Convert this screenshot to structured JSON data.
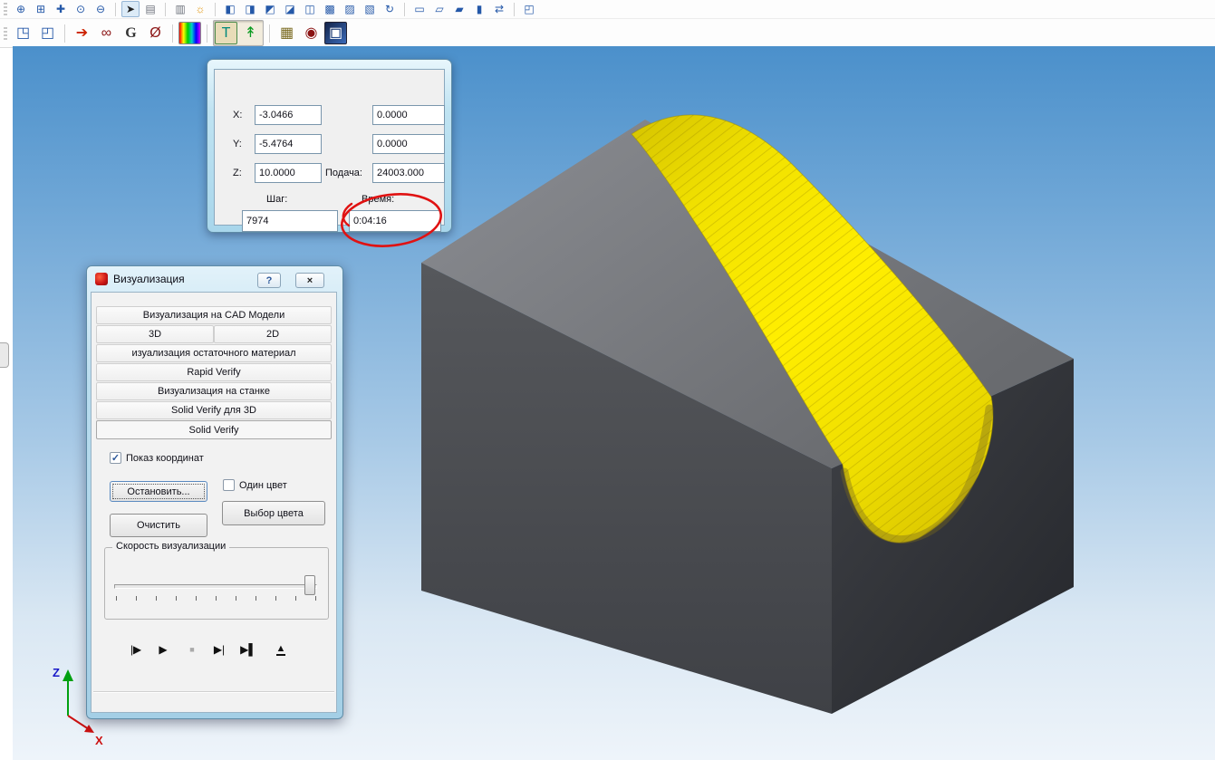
{
  "toolbar_row1": {
    "icons": [
      {
        "name": "zoom-in",
        "glyph": "⊕"
      },
      {
        "name": "zoom-window",
        "glyph": "⊞"
      },
      {
        "name": "pan",
        "glyph": "✚"
      },
      {
        "name": "zoom-dynamic",
        "glyph": "⊙"
      },
      {
        "name": "zoom-previous",
        "glyph": "⊖"
      },
      {
        "name": "select-cursor",
        "glyph": "➤"
      },
      {
        "name": "measure",
        "glyph": "▤"
      },
      {
        "name": "notes",
        "glyph": "▥"
      },
      {
        "name": "light",
        "glyph": "☼"
      },
      {
        "name": "view-front",
        "glyph": "◧"
      },
      {
        "name": "view-back",
        "glyph": "◨"
      },
      {
        "name": "view-left",
        "glyph": "◩"
      },
      {
        "name": "view-right",
        "glyph": "◪"
      },
      {
        "name": "view-top",
        "glyph": "◫"
      },
      {
        "name": "view-bottom",
        "glyph": "▩"
      },
      {
        "name": "view-isometric",
        "glyph": "▨"
      },
      {
        "name": "view-dimetric",
        "glyph": "▧"
      },
      {
        "name": "view-rotate",
        "glyph": "↻"
      },
      {
        "name": "render-wireframe",
        "glyph": "▭"
      },
      {
        "name": "render-hidden-line",
        "glyph": "▱"
      },
      {
        "name": "render-shaded",
        "glyph": "▰"
      },
      {
        "name": "render-solid",
        "glyph": "▮"
      },
      {
        "name": "view-refresh",
        "glyph": "⇄"
      },
      {
        "name": "viewport-layout",
        "glyph": "◰"
      }
    ]
  },
  "toolbar_row2": {
    "icons": [
      {
        "name": "sim-window",
        "glyph": "◳"
      },
      {
        "name": "sim-window-secondary",
        "glyph": "◰"
      },
      {
        "name": "import-toolpath",
        "glyph": "➔"
      },
      {
        "name": "machine-view",
        "glyph": "∞"
      },
      {
        "name": "gcode",
        "glyph": "G"
      },
      {
        "name": "postprocess",
        "glyph": "Ø"
      },
      {
        "name": "color-spectrum",
        "glyph": ""
      },
      {
        "name": "tool-visibility",
        "glyph": "T"
      },
      {
        "name": "toolpath-visibility",
        "glyph": "↟"
      },
      {
        "name": "stock-model",
        "glyph": "▦"
      },
      {
        "name": "collision-check",
        "glyph": "◉"
      },
      {
        "name": "sim-snapshot",
        "glyph": "▣"
      }
    ]
  },
  "coord_panel": {
    "x_label": "X:",
    "x_value": "-3.0466",
    "x_value2": "0.0000",
    "y_label": "Y:",
    "y_value": "-5.4764",
    "y_value2": "0.0000",
    "z_label": "Z:",
    "z_value": "10.0000",
    "feed_label": "Подача:",
    "feed_value": "24003.000",
    "step_label": "Шаг:",
    "step_value": "7974",
    "time_label": "Время:",
    "time_value": "0:04:16"
  },
  "viz_dialog": {
    "title": "Визуализация",
    "help": "?",
    "close": "×",
    "tabs": [
      "Визуализация на CAD Модели",
      "3D",
      "2D",
      "изуализация остаточного материал",
      "Rapid Verify",
      "Визуализация на станке",
      "Solid Verify для 3D",
      "Solid Verify"
    ],
    "show_coords_label": "Показ координат",
    "show_coords_check": "✓",
    "stop_button": "Остановить...",
    "clear_button": "Очистить",
    "one_color_label": "Один цвет",
    "choose_color_button": "Выбор цвета",
    "speed_group_label": "Скорость визуализации",
    "playback": [
      {
        "name": "play-from-start",
        "glyph": "|▶"
      },
      {
        "name": "play",
        "glyph": "▶"
      },
      {
        "name": "stop",
        "glyph": "■"
      },
      {
        "name": "play-to-end",
        "glyph": "▶|"
      },
      {
        "name": "step-forward",
        "glyph": "▶▌"
      },
      {
        "name": "eject",
        "glyph": "▲"
      }
    ]
  },
  "axes": {
    "z_label": "Z",
    "x_label": "X"
  },
  "colors": {
    "stock_yellow": "#ffee00",
    "block_gray": "#4a4c50",
    "annotation_red": "#e01212",
    "viewport_top_blue": "#4b90cb"
  }
}
